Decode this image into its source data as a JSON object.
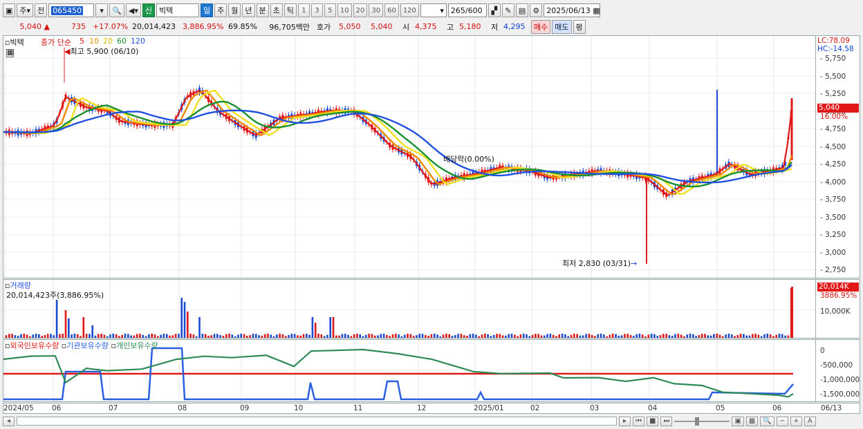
{
  "toolbar": {
    "period_short": "주",
    "period_prev": "전",
    "code": "065450",
    "name_badge": "신",
    "stock_name": "빅텍",
    "periods": [
      "일",
      "주",
      "월",
      "년",
      "분",
      "초",
      "틱"
    ],
    "intervals": [
      "1",
      "3",
      "5",
      "10",
      "20",
      "30",
      "60",
      "120"
    ],
    "count_value": "265",
    "count_total": "/600",
    "date": "2025/06/13"
  },
  "quote": {
    "price": "5,040",
    "arrow": "▲",
    "change": "735",
    "change_pct": "+17.07%",
    "volume": "20,014,423",
    "volume_pct": "3,886.95%",
    "turnover": "69.85%",
    "amount": "96,705백만",
    "hoga_label": "호가",
    "hoga_ask": "5,050",
    "hoga_bid": "5,040",
    "open_label": "시",
    "open": "4,375",
    "high_label": "고",
    "high": "5,180",
    "low_label": "저",
    "low": "4,295",
    "buy": "매수",
    "sell": "매도",
    "eval": "평"
  },
  "price_pane": {
    "title": "빅텍",
    "ma_label": "종가 단순",
    "ma_periods": [
      "5",
      "10",
      "20",
      "60",
      "120"
    ],
    "ma_colors": [
      "#e01818",
      "#f08a00",
      "#f0e020",
      "#189030",
      "#2050e0"
    ],
    "high_note": "최고 5,900 (06/10)",
    "low_note": "최저 2,830 (03/31)",
    "dividend_note": "배당락(0.00%)",
    "lc": "LC:78.09",
    "hc": "HC:-14.58",
    "current_tag": "5,040",
    "pct_tag": "16.00%",
    "y_ticks": [
      "5,750",
      "5,500",
      "5,250",
      "5,000",
      "4,750",
      "4,500",
      "4,250",
      "4,000",
      "3,750",
      "3,500",
      "3,250",
      "3,000",
      "2,750"
    ]
  },
  "volume_pane": {
    "title": "거래량",
    "value": "20,014,423주(3,886.95%)",
    "tag_value": "20,014K",
    "tag_pct": "3886.95%",
    "y_tick": "10,000K"
  },
  "holding_pane": {
    "series": [
      "외국인보유수량",
      "기관보유수량",
      "개인보유수량"
    ],
    "series_colors": [
      "#e01818",
      "#2a5fe0",
      "#2e8b57"
    ],
    "y_ticks": [
      "0",
      "-500,000",
      "-1,000,000",
      "-1,500,000"
    ]
  },
  "x_axis": {
    "labels": [
      "2024/05",
      "06",
      "07",
      "08",
      "09",
      "10",
      "11",
      "12",
      "2025/01",
      "02",
      "03",
      "04",
      "05",
      "06"
    ],
    "end_label": "06/13"
  }
}
